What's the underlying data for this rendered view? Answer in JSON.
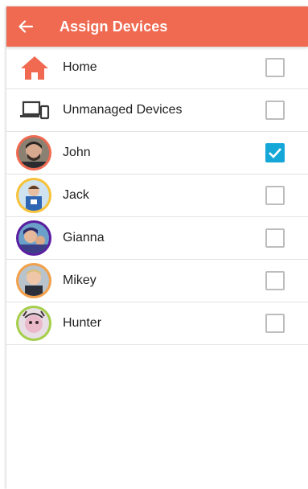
{
  "header": {
    "title": "Assign Devices",
    "back_icon": "arrow-back-icon"
  },
  "items": [
    {
      "label": "Home",
      "icon": "home-icon",
      "checked": false
    },
    {
      "label": "Unmanaged Devices",
      "icon": "devices-icon",
      "checked": false
    },
    {
      "label": "John",
      "icon": "avatar",
      "ring": "#ef6a51",
      "checked": true
    },
    {
      "label": "Jack",
      "icon": "avatar",
      "ring": "#f6c33a",
      "checked": false
    },
    {
      "label": "Gianna",
      "icon": "avatar",
      "ring": "#5a1ea0",
      "checked": false
    },
    {
      "label": "Mikey",
      "icon": "avatar",
      "ring": "#f3a04a",
      "checked": false
    },
    {
      "label": "Hunter",
      "icon": "avatar",
      "ring": "#a5cf4a",
      "checked": false
    }
  ],
  "colors": {
    "accent": "#ef6a51",
    "checkbox_on": "#16a7d9",
    "checkbox_off": "#bdbdbd"
  }
}
